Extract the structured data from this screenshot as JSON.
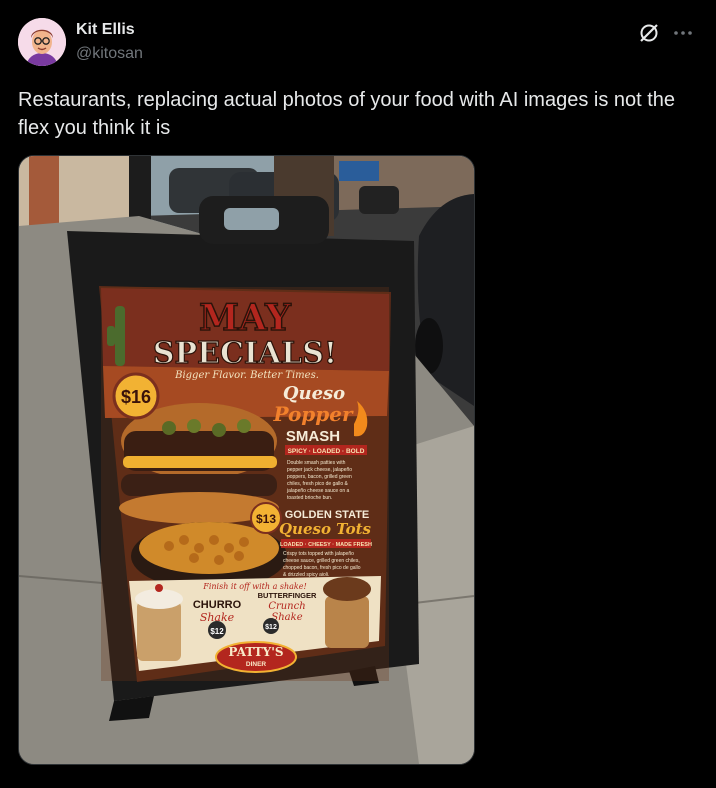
{
  "author": {
    "display_name": "Kit Ellis",
    "handle": "@kitosan"
  },
  "post": {
    "text": "Restaurants, replacing actual photos of your food with AI images is not the flex you think it is"
  },
  "icons": {
    "grok": "grok-icon",
    "more": "more-options-icon"
  },
  "photo": {
    "sign": {
      "headline_1": "MAY",
      "headline_2": "SPECIALS!",
      "tagline": "Bigger Flavor. Better Times.",
      "burger_price": "$16",
      "burger_name_1": "Queso",
      "burger_name_2": "Popper",
      "burger_name_3": "SMASH",
      "burger_tags": "SPICY · LOADED · BOLD",
      "burger_desc": "Double smash patties with pepper jack cheese, jalapeño poppers, bacon, grilled green chiles, fresh pico de gallo & jalapeño cheese sauce on a toasted brioche bun.",
      "tots_price": "$13",
      "tots_name_1": "GOLDEN STATE",
      "tots_name_2": "Queso Tots",
      "tots_tags": "LOADED · CHEESY · MADE FRESH",
      "tots_desc": "Crispy tots topped with jalapeño cheese sauce, grilled green chiles, chopped bacon, fresh pico de gallo & drizzled spicy aioli.",
      "shake_header": "Finish it off with a shake!",
      "shake1_name_1": "CHURRO",
      "shake1_name_2": "Shake",
      "shake1_price": "$12",
      "shake2_name_1": "BUTTERFINGER",
      "shake2_name_2": "Crunch",
      "shake2_name_3": "Shake",
      "shake2_price": "$12",
      "brand_1": "PATTY'S",
      "brand_2": "DINER"
    }
  },
  "colors": {
    "background": "#000000",
    "text_primary": "#e7e9ea",
    "text_secondary": "#71767b",
    "border": "#2f3336",
    "sign_red": "#b3261e",
    "sign_gold": "#f2b233"
  }
}
